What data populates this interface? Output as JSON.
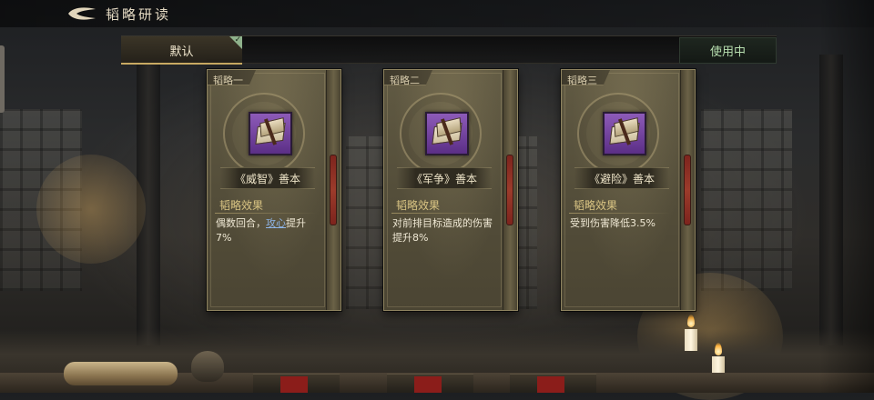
{
  "header": {
    "title": "韬略研读"
  },
  "preset_bar": {
    "selected_preset": "默认",
    "status_button": "使用中"
  },
  "cards": [
    {
      "slot_label": "韬略一",
      "book_name": "《威智》善本",
      "effect_title": "韬略效果",
      "effect_text_before": "偶数回合，",
      "effect_keyword": "攻心",
      "effect_text_after": "提升7%"
    },
    {
      "slot_label": "韬略二",
      "book_name": "《军争》善本",
      "effect_title": "韬略效果",
      "effect_text": "对前排目标造成的伤害提升8%"
    },
    {
      "slot_label": "韬略三",
      "book_name": "《避险》善本",
      "effect_title": "韬略效果",
      "effect_text": "受到伤害降低3.5%"
    }
  ],
  "colors": {
    "effect_title": "#d9c483",
    "keyword_link": "#8fb6e8",
    "in_use_text": "#b8dfb0",
    "book_icon_bg": "#7a48a8"
  },
  "icons": {
    "back": "back-arrow-icon",
    "selected_check": "check-icon",
    "book": "tactics-book-icon"
  }
}
